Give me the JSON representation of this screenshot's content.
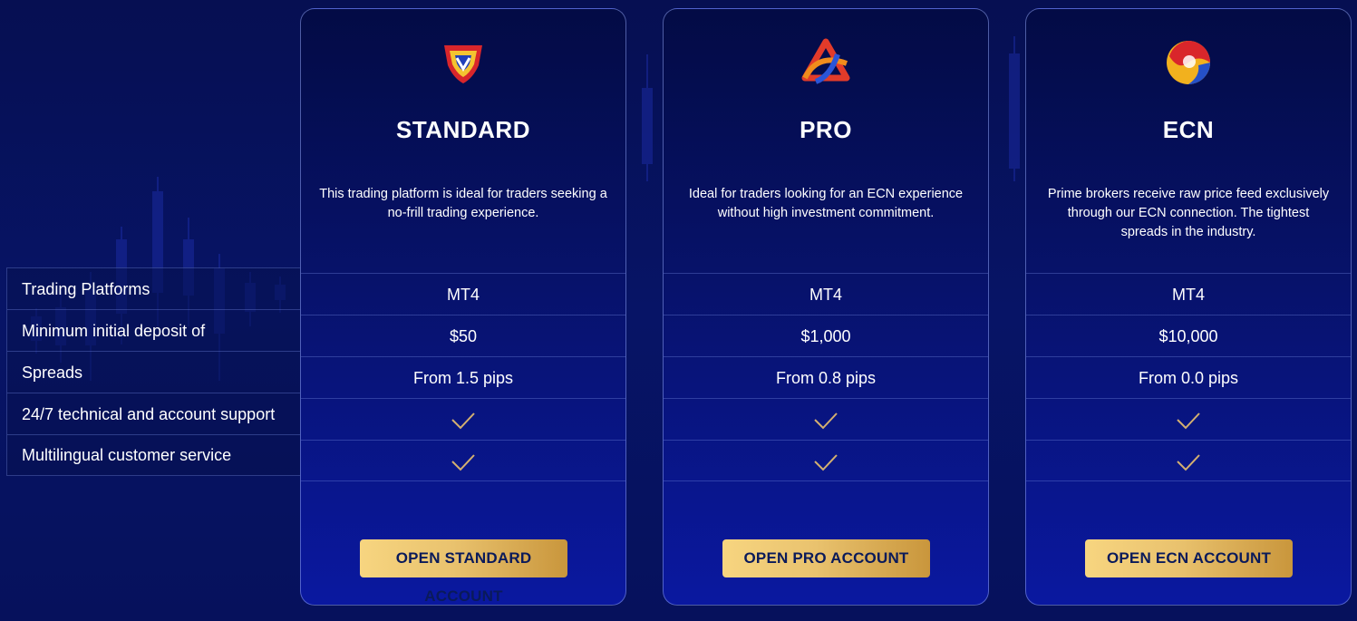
{
  "row_labels": [
    "Trading Platforms",
    "Minimum initial deposit of",
    "Spreads",
    "24/7 technical and account support",
    "Multilingual customer service"
  ],
  "plans": [
    {
      "logo_icon": "shield-logo-icon",
      "title": "STANDARD",
      "description": "This trading platform is ideal for traders seeking a no-frill trading experience.",
      "platform": "MT4",
      "deposit": "$50",
      "spreads": "From 1.5 pips",
      "support": "check",
      "multilingual": "check",
      "cta": "OPEN STANDARD ACCOUNT"
    },
    {
      "logo_icon": "triangle-logo-icon",
      "title": "PRO",
      "description": "Ideal for traders looking for an ECN experience without high investment commitment.",
      "platform": "MT4",
      "deposit": "$1,000",
      "spreads": "From 0.8 pips",
      "support": "check",
      "multilingual": "check",
      "cta": "OPEN PRO ACCOUNT"
    },
    {
      "logo_icon": "sphere-logo-icon",
      "title": "ECN",
      "description": "Prime brokers receive raw price feed exclusively through our ECN connection. The tightest spreads in the industry.",
      "platform": "MT4",
      "deposit": "$10,000",
      "spreads": "From 0.0 pips",
      "support": "check",
      "multilingual": "check",
      "cta": "OPEN ECN ACCOUNT"
    }
  ],
  "colors": {
    "background": "#071466",
    "cta_gold_start": "#f7d580",
    "cta_gold_end": "#c9963c",
    "check": "#d4b070"
  }
}
